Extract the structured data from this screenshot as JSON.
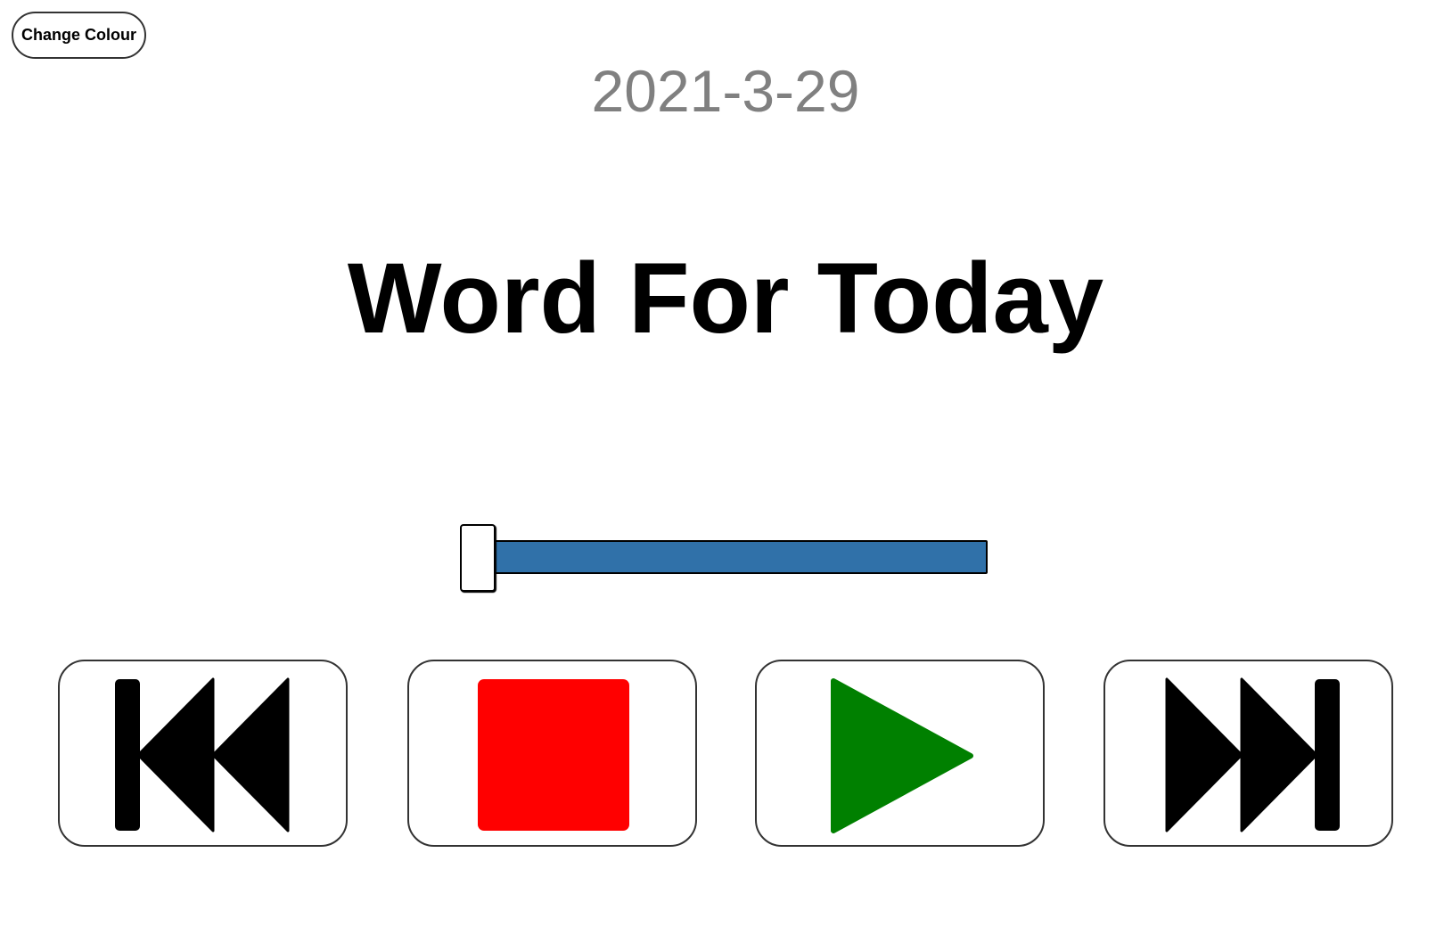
{
  "toolbar": {
    "change_colour_label": "Change Colour"
  },
  "header": {
    "date": "2021-3-29",
    "title": "Word For Today"
  },
  "player": {
    "progress_fraction": 0,
    "controls": [
      {
        "name": "skip-back",
        "icon": "skip-back-icon"
      },
      {
        "name": "stop",
        "icon": "stop-icon",
        "color": "#ff0000"
      },
      {
        "name": "play",
        "icon": "play-icon",
        "color": "#008000"
      },
      {
        "name": "skip-forward",
        "icon": "skip-forward-icon"
      }
    ],
    "track_color": "#3071a9"
  }
}
